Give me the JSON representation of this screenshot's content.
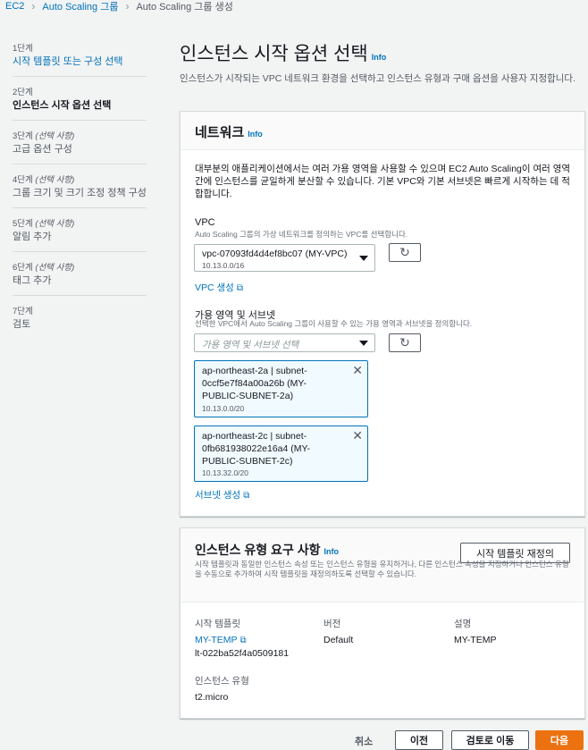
{
  "breadcrumb": {
    "items": [
      "EC2",
      "Auto Scaling 그룹",
      "Auto Scaling 그룹 생성"
    ],
    "separator": ">"
  },
  "steps": [
    {
      "num": "1단계",
      "num_note": "",
      "name": "시작 템플릿 또는 구성 선택",
      "state": "link"
    },
    {
      "num": "2단계",
      "num_note": "",
      "name": "인스턴스 시작 옵션 선택",
      "state": "active"
    },
    {
      "num": "3단계",
      "num_note": "(선택 사항)",
      "name": "고급 옵션 구성",
      "state": "disabled"
    },
    {
      "num": "4단계",
      "num_note": "(선택 사항)",
      "name": "그룹 크기 및 크기 조정 정책 구성",
      "state": "disabled"
    },
    {
      "num": "5단계",
      "num_note": "(선택 사항)",
      "name": "알림 추가",
      "state": "disabled"
    },
    {
      "num": "6단계",
      "num_note": "(선택 사항)",
      "name": "태그 추가",
      "state": "disabled"
    },
    {
      "num": "7단계",
      "num_note": "",
      "name": "검토",
      "state": "disabled"
    }
  ],
  "page": {
    "title": "인스턴스 시작 옵션 선택",
    "info": "Info",
    "subtitle": "인스턴스가 시작되는 VPC 네트워크 환경을 선택하고 인스턴스 유형과 구매 옵션을 사용자 지정합니다."
  },
  "network": {
    "title": "네트워크",
    "info": "Info",
    "description": "대부분의 애플리케이션에서는 여러 가용 영역을 사용할 수 있으며 EC2 Auto Scaling이 여러 영역 간에 인스턴스를 균일하게 분산할 수 있습니다. 기본 VPC와 기본 서브넷은 빠르게 시작하는 데 적합합니다.",
    "vpc_label": "VPC",
    "vpc_desc": "Auto Scaling 그룹의 가상 네트워크를 정의하는 VPC를 선택합니다.",
    "vpc_value": "vpc-07093fd4d4ef8bc07 (MY-VPC)",
    "vpc_cidr": "10.13.0.0/16",
    "create_vpc": "VPC 생성",
    "az_label": "가용 영역 및 서브넷",
    "az_desc": "선택한 VPC에서 Auto Scaling 그룹이 사용할 수 있는 가용 영역과 서브넷을 정의합니다.",
    "az_placeholder": "가용 영역 및 서브넷 선택",
    "subnets": [
      {
        "title": "ap-northeast-2a | subnet-0ccf5e7f84a00a26b (MY-PUBLIC-SUBNET-2a)",
        "cidr": "10.13.0.0/20"
      },
      {
        "title": "ap-northeast-2c | subnet-0fb681938022e16a4 (MY-PUBLIC-SUBNET-2c)",
        "cidr": "10.13.32.0/20"
      }
    ],
    "create_subnet": "서브넷 생성"
  },
  "instance_type": {
    "title": "인스턴스 유형 요구 사항",
    "info": "Info",
    "reset_button": "시작 템플릿 재정의",
    "description": "시작 템플릿과 동일한 인스턴스 속성 또는 인스턴스 유형을 유지하거나, 다른 인스턴스 속성을 지정하거나 인스턴스 유형을 수동으로 추가하여 시작 템플릿을 재정의하도록 선택할 수 있습니다.",
    "col_template": "시작 템플릿",
    "col_version": "버전",
    "col_desc": "설명",
    "template_name": "MY-TEMP",
    "template_id": "lt-022ba52f4a0509181",
    "version": "Default",
    "template_desc": "MY-TEMP",
    "instance_type_label": "인스턴스 유형",
    "instance_type_value": "t2.micro"
  },
  "footer": {
    "cancel": "취소",
    "previous": "이전",
    "skip_review": "검토로 이동",
    "next": "다음"
  },
  "colors": {
    "link": "#0073bb",
    "primary": "#ec7211",
    "background": "#f2f3f3"
  }
}
